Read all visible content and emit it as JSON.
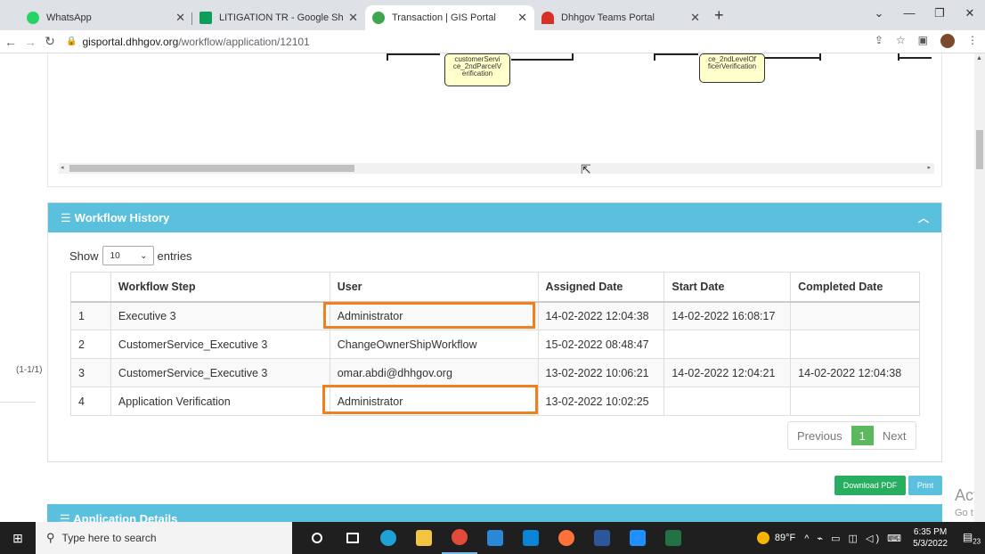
{
  "browser": {
    "tabs": [
      {
        "title": "WhatsApp",
        "favicon_color": "#25d366",
        "active": false
      },
      {
        "title": "LITIGATION TR - Google Sheets",
        "favicon_color": "#0f9d58",
        "active": false
      },
      {
        "title": "Transaction | GIS Portal",
        "favicon_color": "#3ea64e",
        "active": true
      },
      {
        "title": "Dhhgov Teams Portal",
        "favicon_color": "#d93025",
        "active": false
      }
    ],
    "new_tab": "+",
    "url_host": "gisportal.dhhgov.org",
    "url_path": "/workflow/application/12101"
  },
  "diagram": {
    "node1": "customerServi ce_2ndParcelV erification",
    "node2": "ce_2ndLevelOf ficerVerification"
  },
  "workflow_history": {
    "title": "Workflow History",
    "show_label": "Show",
    "entries_value": "10",
    "entries_label": "entries",
    "columns": [
      "",
      "Workflow Step",
      "User",
      "Assigned Date",
      "Start Date",
      "Completed Date"
    ],
    "rows": [
      [
        "1",
        "Executive 3",
        "Administrator",
        "14-02-2022 12:04:38",
        "14-02-2022 16:08:17",
        ""
      ],
      [
        "2",
        "CustomerService_Executive 3",
        "ChangeOwnerShipWorkflow",
        "15-02-2022 08:48:47",
        "",
        ""
      ],
      [
        "3",
        "CustomerService_Executive 3",
        "omar.abdi@dhhgov.org",
        "13-02-2022 10:06:21",
        "14-02-2022 12:04:21",
        "14-02-2022 12:04:38"
      ],
      [
        "4",
        "Application Verification",
        "Administrator",
        "13-02-2022 10:02:25",
        "",
        ""
      ]
    ],
    "pager": {
      "previous": "Previous",
      "current": "1",
      "next": "Next"
    }
  },
  "buttons": {
    "download_pdf": "Download PDF",
    "print": "Print"
  },
  "application_details": {
    "title": "Application Details"
  },
  "side_label": "(1-1/1)",
  "watermark": {
    "line1": "Acti",
    "line2": "Go t"
  },
  "taskbar": {
    "search_placeholder": "Type here to search",
    "apps": [
      {
        "name": "cortana-icon",
        "color": "#ffffff"
      },
      {
        "name": "task-view-icon",
        "color": "#ffffff"
      },
      {
        "name": "edge-icon",
        "color": "#1fa1d5"
      },
      {
        "name": "file-explorer-icon",
        "color": "#f5c342"
      },
      {
        "name": "chrome-icon",
        "color": "#e24a3b"
      },
      {
        "name": "store-icon",
        "color": "#2b88d8"
      },
      {
        "name": "mail-icon",
        "color": "#0a84d6"
      },
      {
        "name": "firefox-icon",
        "color": "#ff7139"
      },
      {
        "name": "word-icon",
        "color": "#2b579a"
      },
      {
        "name": "powerpoint-icon",
        "color": "#1e90ff"
      },
      {
        "name": "excel-icon",
        "color": "#217346"
      }
    ],
    "temperature": "89°F",
    "time": "6:35 PM",
    "date": "5/3/2022",
    "notifications": "23"
  },
  "colors": {
    "panel_header": "#5bc0de",
    "highlight": "#f07f1e",
    "pager_active": "#5cb85c",
    "pdf_button": "#27ae60"
  }
}
